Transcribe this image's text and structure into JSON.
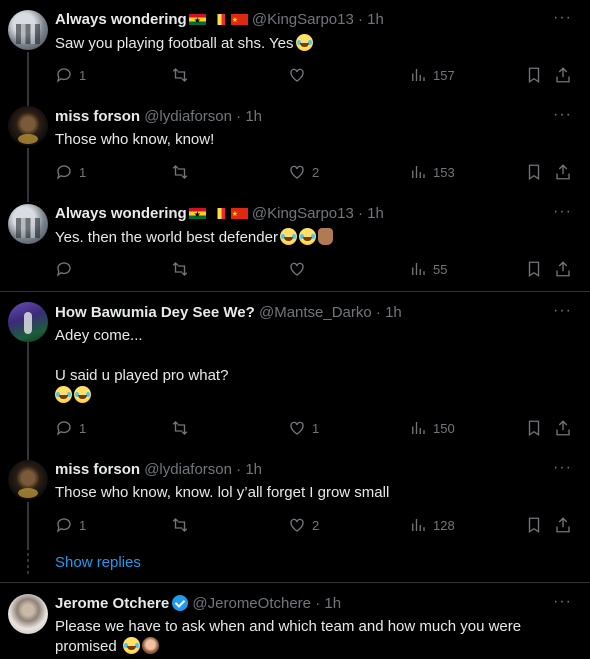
{
  "tweets": [
    {
      "name": "Always wondering",
      "handle": "@KingSarpo13",
      "time": "· 1h",
      "text": "Saw you playing football at shs. Yes",
      "stats": {
        "replies": "1",
        "retweets": "",
        "likes": "",
        "views": "157"
      }
    },
    {
      "name": "miss forson",
      "handle": "@lydiaforson",
      "time": "· 1h",
      "text": "Those who know, know!",
      "stats": {
        "replies": "1",
        "retweets": "",
        "likes": "2",
        "views": "153"
      }
    },
    {
      "name": "Always wondering",
      "handle": "@KingSarpo13",
      "time": "· 1h",
      "text": "Yes. then the world best defender",
      "stats": {
        "replies": "",
        "retweets": "",
        "likes": "",
        "views": "55"
      }
    },
    {
      "name": "How Bawumia Dey See We?",
      "handle": "@Mantse_Darko",
      "time": "· 1h",
      "text": "Adey come...",
      "text2": "U said u played pro what?",
      "stats": {
        "replies": "1",
        "retweets": "",
        "likes": "1",
        "views": "150"
      }
    },
    {
      "name": "miss forson",
      "handle": "@lydiaforson",
      "time": "· 1h",
      "text": "Those who know, know. lol y’all forget I grow small",
      "stats": {
        "replies": "1",
        "retweets": "",
        "likes": "2",
        "views": "128"
      }
    },
    {
      "name": "Jerome Otchere",
      "handle": "@JeromeOtchere",
      "time": "· 1h",
      "text": "Please we have to ask when and which team and how much you were",
      "text2": "promised"
    }
  ],
  "show_replies": "Show replies",
  "more_label": "···",
  "icons": {
    "reply": "reply-icon",
    "retweet": "retweet-icon",
    "like": "heart-icon",
    "views": "views-icon",
    "bookmark": "bookmark-icon",
    "share": "share-icon",
    "verified": "verified-badge-icon",
    "more": "more-icon"
  },
  "colors": {
    "background": "#000000",
    "text": "#e7e9ea",
    "muted": "#71767b",
    "link": "#1d9bf0",
    "divider": "#2f3336"
  }
}
